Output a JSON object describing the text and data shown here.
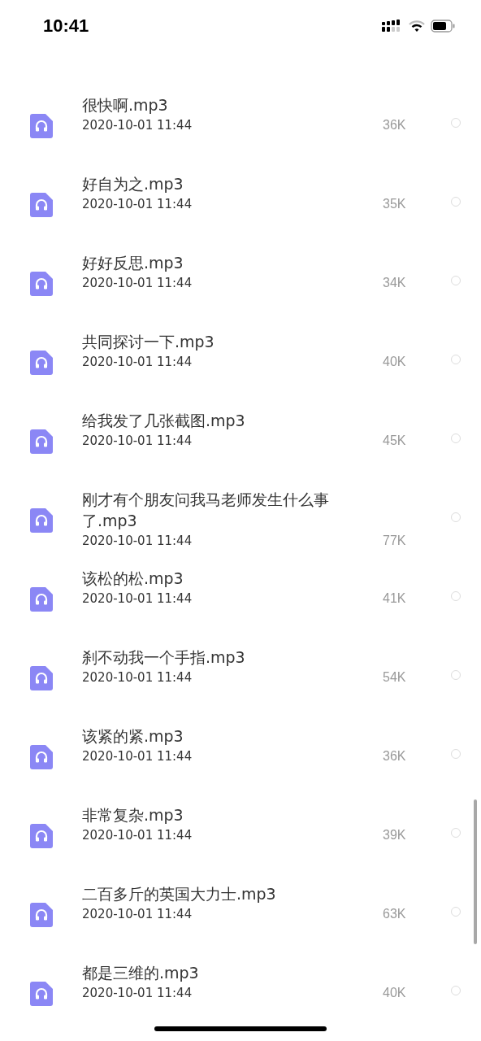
{
  "status_bar": {
    "time": "10:41"
  },
  "files": [
    {
      "name": "很快啊.mp3",
      "date": "2020-10-01 11:44",
      "size": "36K",
      "selected": false
    },
    {
      "name": "好自为之.mp3",
      "date": "2020-10-01 11:44",
      "size": "35K",
      "selected": false
    },
    {
      "name": "好好反思.mp3",
      "date": "2020-10-01 11:44",
      "size": "34K",
      "selected": false
    },
    {
      "name": "共同探讨一下.mp3",
      "date": "2020-10-01 11:44",
      "size": "40K",
      "selected": false
    },
    {
      "name": "给我发了几张截图.mp3",
      "date": "2020-10-01 11:44",
      "size": "45K",
      "selected": false
    },
    {
      "name": "刚才有个朋友问我马老师发生什么事了.mp3",
      "date": "2020-10-01 11:44",
      "size": "77K",
      "selected": false
    },
    {
      "name": "该松的松.mp3",
      "date": "2020-10-01 11:44",
      "size": "41K",
      "selected": false
    },
    {
      "name": "刹不动我一个手指.mp3",
      "date": "2020-10-01 11:44",
      "size": "54K",
      "selected": false
    },
    {
      "name": "该紧的紧.mp3",
      "date": "2020-10-01 11:44",
      "size": "36K",
      "selected": false
    },
    {
      "name": "非常复杂.mp3",
      "date": "2020-10-01 11:44",
      "size": "39K",
      "selected": false
    },
    {
      "name": "二百多斤的英国大力士.mp3",
      "date": "2020-10-01 11:44",
      "size": "63K",
      "selected": false
    },
    {
      "name": "都是三维的.mp3",
      "date": "2020-10-01 11:44",
      "size": "40K",
      "selected": false
    }
  ]
}
